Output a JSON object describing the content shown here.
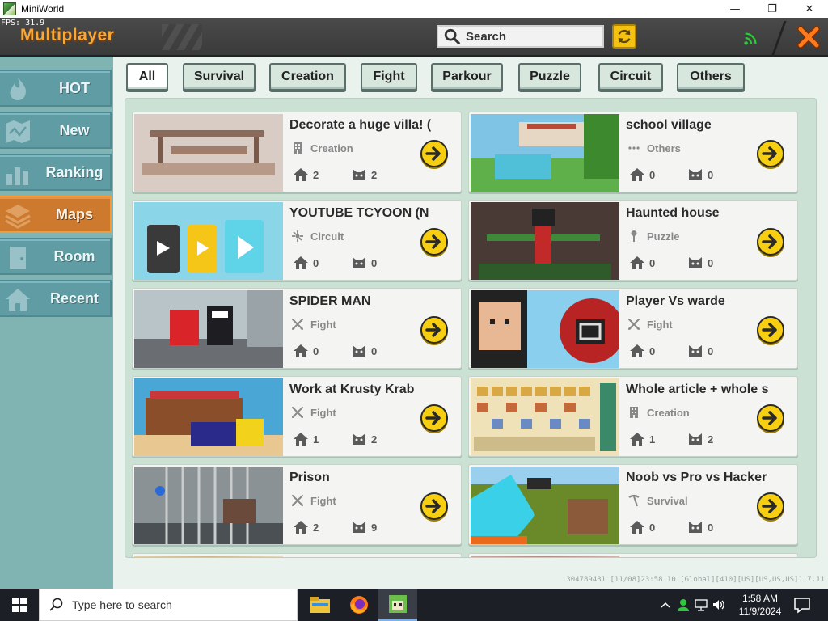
{
  "window": {
    "title": "MiniWorld",
    "minimize_glyph": "—",
    "maximize_glyph": "❐",
    "close_glyph": "✕"
  },
  "header": {
    "fps": "FPS: 31.9",
    "title": "Multiplayer",
    "search_label": "Search"
  },
  "sidebar": {
    "items": [
      {
        "label": "HOT",
        "icon": "flame-icon",
        "active": false
      },
      {
        "label": "New",
        "icon": "map-icon",
        "active": false
      },
      {
        "label": "Ranking",
        "icon": "bar-chart-icon",
        "active": false
      },
      {
        "label": "Maps",
        "icon": "layers-icon",
        "active": true
      },
      {
        "label": "Room",
        "icon": "door-icon",
        "active": false
      },
      {
        "label": "Recent",
        "icon": "house-icon",
        "active": false
      }
    ]
  },
  "filters": [
    "All",
    "Survival",
    "Creation",
    "Fight",
    "Parkour",
    "Puzzle",
    "Circuit",
    "Others"
  ],
  "active_filter": "All",
  "maps": [
    {
      "title": "Decorate a huge villa! (",
      "category": "Creation",
      "cat_icon": "building-icon",
      "rooms": "2",
      "players": "2"
    },
    {
      "title": "school village",
      "category": "Others",
      "cat_icon": "dots-icon",
      "rooms": "0",
      "players": "0"
    },
    {
      "title": "YOUTUBE TCYOON (N",
      "category": "Circuit",
      "cat_icon": "circuit-icon",
      "rooms": "0",
      "players": "0"
    },
    {
      "title": "Haunted house",
      "category": "Puzzle",
      "cat_icon": "key-icon",
      "rooms": "0",
      "players": "0"
    },
    {
      "title": "SPIDER MAN",
      "category": "Fight",
      "cat_icon": "swords-icon",
      "rooms": "0",
      "players": "0"
    },
    {
      "title": "Player Vs warde",
      "category": "Fight",
      "cat_icon": "swords-icon",
      "rooms": "0",
      "players": "0"
    },
    {
      "title": "Work at Krusty Krab",
      "category": "Fight",
      "cat_icon": "swords-icon",
      "rooms": "1",
      "players": "2"
    },
    {
      "title": "Whole article + whole s",
      "category": "Creation",
      "cat_icon": "building-icon",
      "rooms": "1",
      "players": "2"
    },
    {
      "title": "Prison",
      "category": "Fight",
      "cat_icon": "swords-icon",
      "rooms": "2",
      "players": "9"
    },
    {
      "title": "Noob vs Pro vs Hacker",
      "category": "Survival",
      "cat_icon": "pickaxe-icon",
      "rooms": "0",
      "players": "0"
    }
  ],
  "footer_info": "304789431 [11/08]23:58 10 [Global][410][US][US,US,US]1.7.11",
  "taskbar": {
    "search_placeholder": "Type here to search",
    "apps": [
      "file-explorer-icon",
      "firefox-icon",
      "miniworld-icon"
    ],
    "time": "1:58 AM",
    "date": "11/9/2024"
  }
}
